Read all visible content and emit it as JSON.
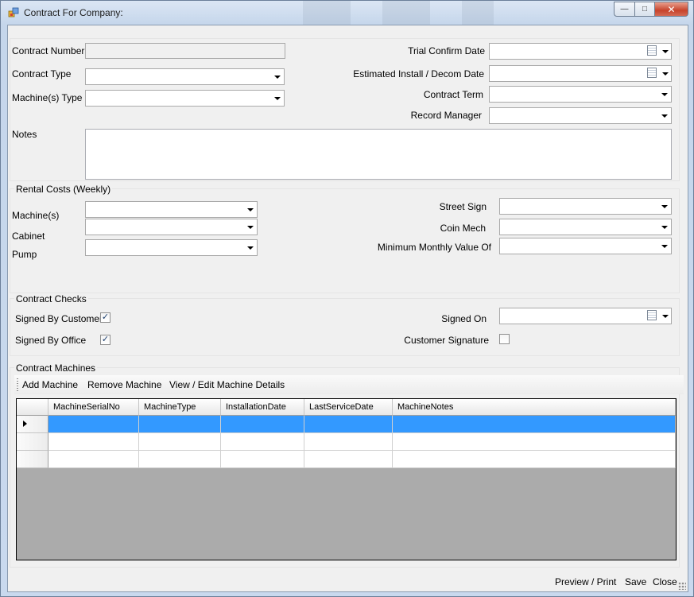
{
  "window": {
    "title": "Contract For Company:",
    "min_glyph": "—",
    "max_glyph": "□",
    "close_glyph": "✕"
  },
  "details": {
    "contract_number_label": "Contract Number",
    "contract_number_value": "",
    "contract_type_label": "Contract Type",
    "contract_type_value": "",
    "machine_type_label": "Machine(s) Type",
    "machine_type_value": "",
    "notes_label": "Notes",
    "notes_value": "",
    "trial_confirm_date_label": "Trial Confirm Date",
    "trial_confirm_date_value": "",
    "est_install_label": "Estimated Install / Decom Date",
    "est_install_value": "",
    "contract_term_label": "Contract Term",
    "contract_term_value": "",
    "record_manager_label": "Record Manager",
    "record_manager_value": ""
  },
  "rental": {
    "title": "Rental Costs (Weekly)",
    "machines_label": "Machine(s)",
    "cabinet_label": "Cabinet",
    "pump_label": "Pump",
    "street_sign_label": "Street Sign",
    "coin_mech_label": "Coin Mech",
    "min_monthly_label": "Minimum Monthly Value Of"
  },
  "checks": {
    "title": "Contract Checks",
    "signed_by_customer_label": "Signed By Customer",
    "signed_by_customer": true,
    "signed_by_office_label": "Signed By Office",
    "signed_by_office": true,
    "signed_on_label": "Signed On",
    "signed_on_value": "",
    "customer_signature_label": "Customer Signature",
    "customer_signature": false,
    "check_glyph": "✓"
  },
  "machines": {
    "title": "Contract Machines",
    "toolbar": {
      "add": "Add Machine",
      "remove": "Remove Machine",
      "view_edit": "View / Edit Machine Details"
    },
    "columns": [
      "MachineSerialNo",
      "MachineType",
      "InstallationDate",
      "LastServiceDate",
      "MachineNotes"
    ],
    "rows": [
      [
        "",
        "",
        "",
        "",
        ""
      ],
      [
        "",
        "",
        "",
        "",
        ""
      ],
      [
        "",
        "",
        "",
        "",
        ""
      ]
    ]
  },
  "footer": {
    "preview_print": "Preview / Print",
    "save": "Save",
    "close": "Close"
  },
  "colors": {
    "selection": "#3399ff",
    "grid_background": "#ababab"
  }
}
